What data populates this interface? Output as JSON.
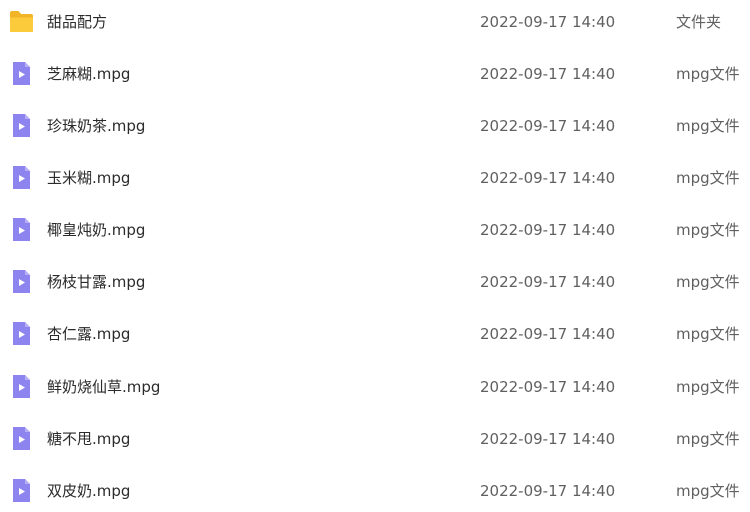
{
  "files": [
    {
      "name": "甜品配方",
      "modified": "2022-09-17 14:40",
      "type": "文件夹",
      "icon": "folder-icon"
    },
    {
      "name": "芝麻糊.mpg",
      "modified": "2022-09-17 14:40",
      "type": "mpg文件",
      "icon": "video-file-icon"
    },
    {
      "name": "珍珠奶茶.mpg",
      "modified": "2022-09-17 14:40",
      "type": "mpg文件",
      "icon": "video-file-icon"
    },
    {
      "name": "玉米糊.mpg",
      "modified": "2022-09-17 14:40",
      "type": "mpg文件",
      "icon": "video-file-icon"
    },
    {
      "name": "椰皇炖奶.mpg",
      "modified": "2022-09-17 14:40",
      "type": "mpg文件",
      "icon": "video-file-icon"
    },
    {
      "name": "杨枝甘露.mpg",
      "modified": "2022-09-17 14:40",
      "type": "mpg文件",
      "icon": "video-file-icon"
    },
    {
      "name": "杏仁露.mpg",
      "modified": "2022-09-17 14:40",
      "type": "mpg文件",
      "icon": "video-file-icon"
    },
    {
      "name": "鲜奶烧仙草.mpg",
      "modified": "2022-09-17 14:40",
      "type": "mpg文件",
      "icon": "video-file-icon"
    },
    {
      "name": "糖不甩.mpg",
      "modified": "2022-09-17 14:40",
      "type": "mpg文件",
      "icon": "video-file-icon"
    },
    {
      "name": "双皮奶.mpg",
      "modified": "2022-09-17 14:40",
      "type": "mpg文件",
      "icon": "video-file-icon"
    }
  ],
  "colors": {
    "folder": "#F9C93A",
    "video_file": "#8E84F0",
    "play_glyph": "#FFFFFF"
  }
}
